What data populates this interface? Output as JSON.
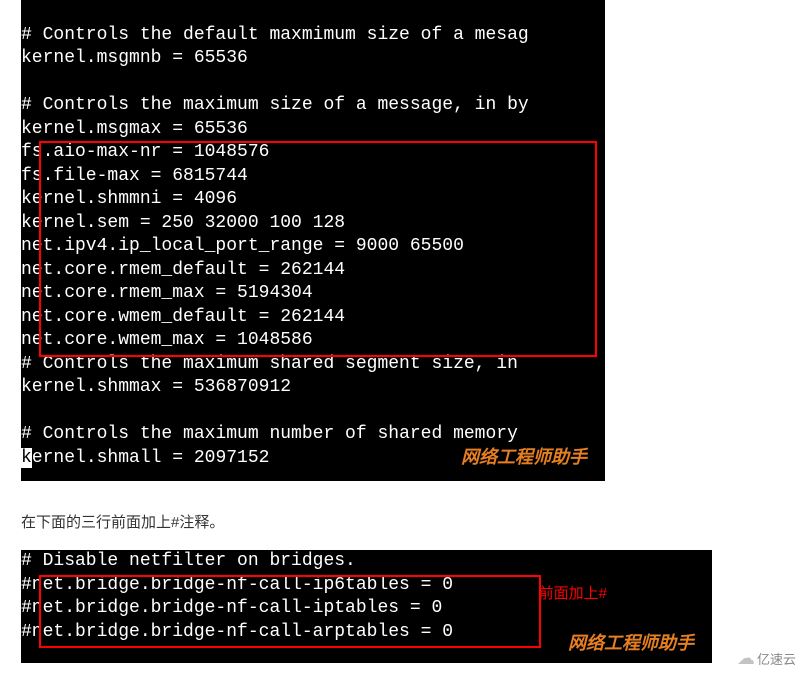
{
  "block1": {
    "l1": "",
    "l2": "# Controls the default maxmimum size of a mesag",
    "l3": "kernel.msgmnb = 65536",
    "l4": "",
    "l5": "# Controls the maximum size of a message, in by",
    "l6": "kernel.msgmax = 65536",
    "l7": "fs.aio-max-nr = 1048576",
    "l8": "fs.file-max = 6815744",
    "l9": "kernel.shmmni = 4096",
    "l10": "kernel.sem = 250 32000 100 128",
    "l11": "net.ipv4.ip_local_port_range = 9000 65500",
    "l12": "net.core.rmem_default = 262144",
    "l13": "net.core.rmem_max = 5194304",
    "l14": "net.core.wmem_default = 262144",
    "l15": "net.core.wmem_max = 1048586",
    "l16": "# Controls the maximum shared segment size, in",
    "l17": "kernel.shmmax = 536870912",
    "l18": "",
    "l19a": "# Controls the maximum number o",
    "l19b": "f shared memory",
    "l20a": "k",
    "l20b": "ernel.shmall = 2097152"
  },
  "middle_text": "在下面的三行前面加上#注释。",
  "block2": {
    "l1": "# Disable netfilter on bridges.",
    "l2": "#net.bridge.bridge-nf-call-ip6tables = 0",
    "l3": "#net.bridge.bridge-nf-call-iptables = 0",
    "l4": "#net.bridge.bridge-nf-call-arptables = 0"
  },
  "watermark1": "网络工程师助手",
  "watermark2": "网络工程师助手",
  "red_label": "前面加上#",
  "cloud_brand": "亿速云"
}
